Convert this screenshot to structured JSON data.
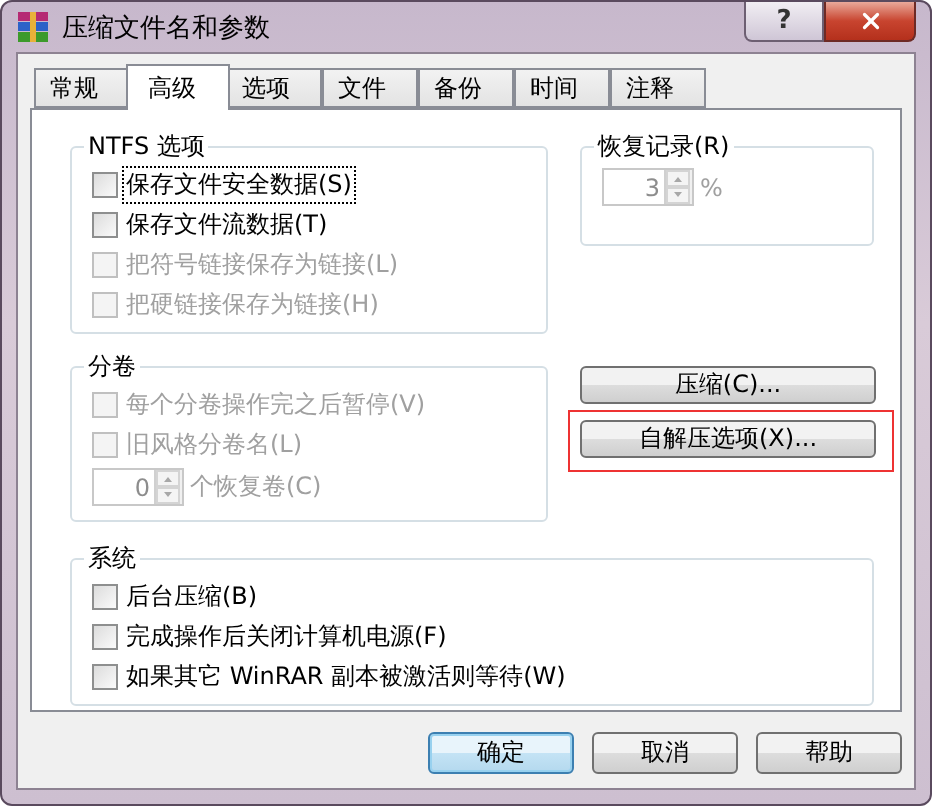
{
  "window": {
    "title": "压缩文件名和参数",
    "help_label": "?"
  },
  "tabs": [
    {
      "label": "常规",
      "selected": false
    },
    {
      "label": "高级",
      "selected": true
    },
    {
      "label": "选项",
      "selected": false
    },
    {
      "label": "文件",
      "selected": false
    },
    {
      "label": "备份",
      "selected": false
    },
    {
      "label": "时间",
      "selected": false
    },
    {
      "label": "注释",
      "selected": false
    }
  ],
  "ntfs_group": {
    "title": "NTFS 选项",
    "options": [
      {
        "label": "保存文件安全数据(S)",
        "checked": false,
        "disabled": false,
        "focused": true
      },
      {
        "label": "保存文件流数据(T)",
        "checked": false,
        "disabled": false,
        "focused": false
      },
      {
        "label": "把符号链接保存为链接(L)",
        "checked": false,
        "disabled": true,
        "focused": false
      },
      {
        "label": "把硬链接保存为链接(H)",
        "checked": false,
        "disabled": true,
        "focused": false
      }
    ]
  },
  "recovery_group": {
    "title": "恢复记录(R)",
    "spin": {
      "value": "3",
      "disabled": true
    },
    "unit": "%"
  },
  "volumes_group": {
    "title": "分卷",
    "options": [
      {
        "label": "每个分卷操作完之后暂停(V)",
        "checked": false,
        "disabled": true,
        "focused": false
      },
      {
        "label": "旧风格分卷名(L)",
        "checked": false,
        "disabled": true,
        "focused": false
      }
    ],
    "spin": {
      "value": "0",
      "disabled": true
    },
    "spin_label": "个恢复卷(C)"
  },
  "action_buttons": [
    {
      "label": "压缩(C)...",
      "highlighted": false
    },
    {
      "label": "自解压选项(X)...",
      "highlighted": true
    }
  ],
  "system_group": {
    "title": "系统",
    "options": [
      {
        "label": "后台压缩(B)",
        "checked": false,
        "disabled": false,
        "focused": false
      },
      {
        "label": "完成操作后关闭计算机电源(F)",
        "checked": false,
        "disabled": false,
        "focused": false
      },
      {
        "label": "如果其它 WinRAR 副本被激活则等待(W)",
        "checked": false,
        "disabled": false,
        "focused": false
      }
    ]
  },
  "footer_buttons": [
    {
      "label": "确定",
      "default": true
    },
    {
      "label": "取消",
      "default": false
    },
    {
      "label": "帮助",
      "default": false
    }
  ]
}
